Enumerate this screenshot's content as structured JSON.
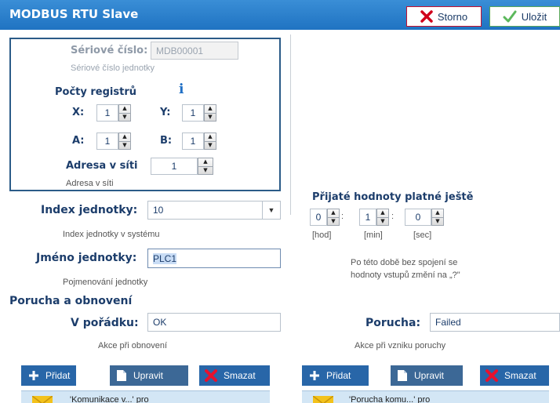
{
  "header": {
    "title": "MODBUS RTU Slave",
    "storno_label": "Storno",
    "save_label": "Uložit"
  },
  "config": {
    "serial_label": "Sériové číslo:",
    "serial_value": "MDB00001",
    "serial_help": "Sériové číslo jednotky",
    "registers_label": "Počty registrů",
    "info_icon_text": "i",
    "x_label": "X:",
    "x_value": "1",
    "y_label": "Y:",
    "y_value": "1",
    "a_label": "A:",
    "a_value": "1",
    "b_label": "B:",
    "b_value": "1",
    "address_label": "Adresa v síti",
    "address_value": "1",
    "address_help": "Adresa v síti"
  },
  "unit": {
    "index_label": "Index jednotky:",
    "index_value": "10",
    "index_help": "Index jednotky v systému",
    "name_label": "Jméno jednotky:",
    "name_value": "PLC1",
    "name_help": "Pojmenování jednotky"
  },
  "validity": {
    "label": "Přijaté hodnoty platné ještě",
    "hours": "0",
    "minutes": "1",
    "seconds": "0",
    "sep": ":",
    "hours_unit": "[hod]",
    "minutes_unit": "[min]",
    "seconds_unit": "[sec]",
    "note_line1": "Po této době bez spojení se",
    "note_line2": "hodnoty vstupů změní na „?\""
  },
  "fault": {
    "section_label": "Porucha a obnovení",
    "ok_label": "V pořádku:",
    "ok_value": "OK",
    "ok_help": "Akce při obnovení",
    "fail_label": "Porucha:",
    "fail_value": "Failed",
    "fail_help": "Akce při vzniku poruchy"
  },
  "actions": {
    "add_label": "Přidat",
    "edit_label": "Upravit",
    "delete_label": "Smazat"
  },
  "lists": {
    "left_item": "'Komunikace v...' pro",
    "right_item": "'Porucha komu...' pro"
  },
  "colors": {
    "title_bar": "#1f73c2",
    "label_blue": "#1c3d6b",
    "storno_border": "#c8102e",
    "action_blue": "#2866a8"
  }
}
